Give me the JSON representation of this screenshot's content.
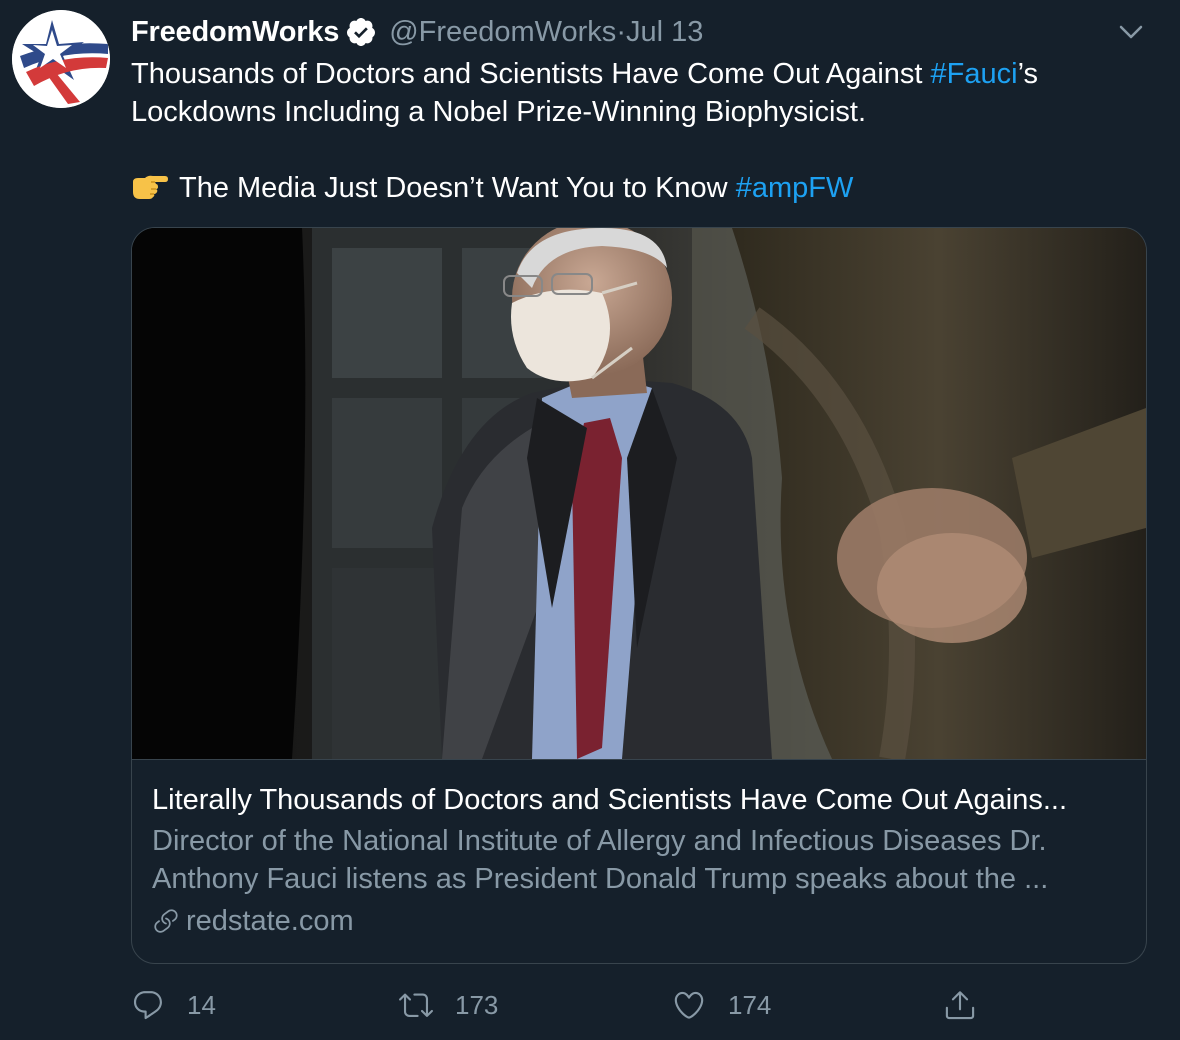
{
  "account": {
    "name": "FreedomWorks",
    "handle": "@FreedomWorks",
    "separator": "·",
    "date": "Jul 13"
  },
  "tweet": {
    "line1_text": "Thousands of Doctors and Scientists Have Come Out Against ",
    "line1_hashtag": "#Fauci",
    "line1_suffix": "’s",
    "line2_text": "Lockdowns Including a Nobel Prize-Winning Biophysicist.",
    "line3_text": "The Media Just Doesn’t Want You to Know ",
    "line3_hashtag": "#ampFW"
  },
  "card": {
    "title": "Literally Thousands of Doctors and Scientists Have Come Out Agains...",
    "description_line1": "Director of the National Institute of Allergy and Infectious Diseases Dr.",
    "description_line2": "Anthony Fauci listens as President Donald Trump speaks about the ...",
    "domain": "redstate.com"
  },
  "actions": {
    "replies": "14",
    "retweets": "173",
    "likes": "174"
  },
  "colors": {
    "background": "#15202b",
    "accent": "#1da1f2",
    "muted": "#8899a6",
    "border": "#38444d"
  },
  "icons": [
    "verified-badge-icon",
    "chevron-down-icon",
    "pointing-hand-emoji-icon",
    "link-icon",
    "reply-icon",
    "retweet-icon",
    "like-icon",
    "share-icon"
  ]
}
